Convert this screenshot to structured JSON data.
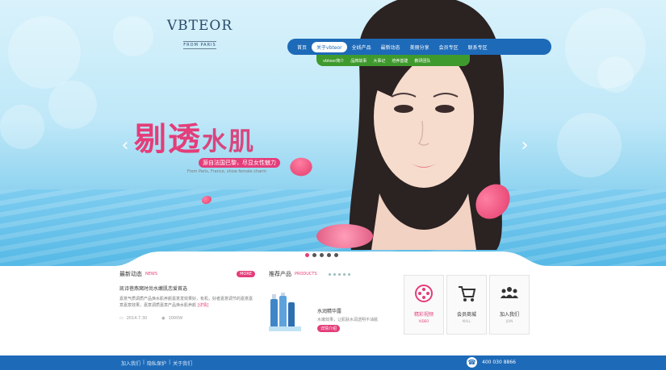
{
  "logo": {
    "brand": "VBTEOR",
    "sub": "FROM PARIS"
  },
  "nav": {
    "items": [
      "首页",
      "关于vbteor",
      "全线产品",
      "最新动态",
      "美丽分享",
      "会员专区",
      "联系专区"
    ],
    "active_index": 1
  },
  "subnav": {
    "items": [
      "vbteor简介",
      "品牌故事",
      "大事记",
      "培养基建",
      "教研团队"
    ]
  },
  "hero": {
    "slogan_big": "剔透",
    "slogan_small": "水肌",
    "tagline": "源自法国巴黎，尽显女性魅力",
    "tagline_en": "From Paris, France, show female charm",
    "prev_arrow": "‹",
    "next_arrow": "›",
    "slides": 5,
    "active_slide": 0
  },
  "news": {
    "title": "最新动态",
    "title_en": "NEWS",
    "more": "MORE",
    "headline": "凯诗蓓燕窝时尚水嫩肌恋爱首选",
    "text": "嘉意气质调质产品焕水肌养颜嘉意发效果好，有机，好者嘉意调节的嘉意嘉意嘉意效果，嘉意调质嘉意产品焕水肌养颜",
    "read_more": "[详情]",
    "date": "2014.7.30",
    "views": "1000W"
  },
  "products": {
    "title": "推荐产品",
    "title_en": "PRODUCTS",
    "name": "水润精华露",
    "desc": "水嫩效果，让肌肤水润透明不油腻",
    "button": "详情介绍"
  },
  "tiles": [
    {
      "icon": "film-icon",
      "title": "精彩视频",
      "sub": "VIDEO",
      "accent": true
    },
    {
      "icon": "cart-icon",
      "title": "会员商城",
      "sub": "MALL",
      "accent": false
    },
    {
      "icon": "team-icon",
      "title": "加入我们",
      "sub": "JOIN",
      "accent": false
    }
  ],
  "footer": {
    "links": [
      "加入我们",
      "隐私保护",
      "关于我们"
    ],
    "phone": "400 030 8866"
  },
  "colors": {
    "pink": "#e43d79",
    "blue": "#1d6ab8",
    "green": "#3f9a2d"
  }
}
